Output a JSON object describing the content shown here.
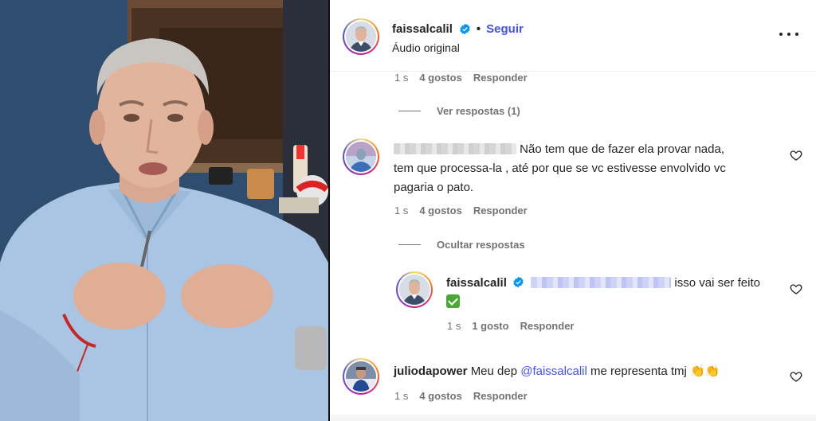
{
  "post": {
    "username": "faissalcalil",
    "separator": "•",
    "follow_label": "Seguir",
    "audio_label": "Áudio original",
    "more_icon": "more-horizontal-icon"
  },
  "comment_prev": {
    "time": "1 s",
    "likes": "4 gostos",
    "reply_label": "Responder",
    "toggle_label": "Ver respostas (1)"
  },
  "comment_1": {
    "text_line1": "Não tem que de fazer ela provar nada,",
    "text_line2": "tem que processa-la , até por que se vc estivesse envolvido vc",
    "text_line3": "pagaria o pato.",
    "time": "1 s",
    "likes": "4 gostos",
    "reply_label": "Responder",
    "toggle_label": "Ocultar respostas"
  },
  "reply_1": {
    "username": "faissalcalil",
    "text": "isso vai ser feito",
    "time": "1 s",
    "likes": "1 gosto",
    "reply_label": "Responder"
  },
  "comment_2": {
    "username": "juliodapower",
    "text_before": "Meu dep",
    "mention": "@faissalcalil",
    "text_after": "me representa tmj",
    "emoji": "👏👏",
    "time": "1 s",
    "likes": "4 gostos",
    "reply_label": "Responder"
  },
  "colors": {
    "link_blue": "#4150f7",
    "verified_blue": "#0095f6",
    "muted_gray": "#737373"
  }
}
